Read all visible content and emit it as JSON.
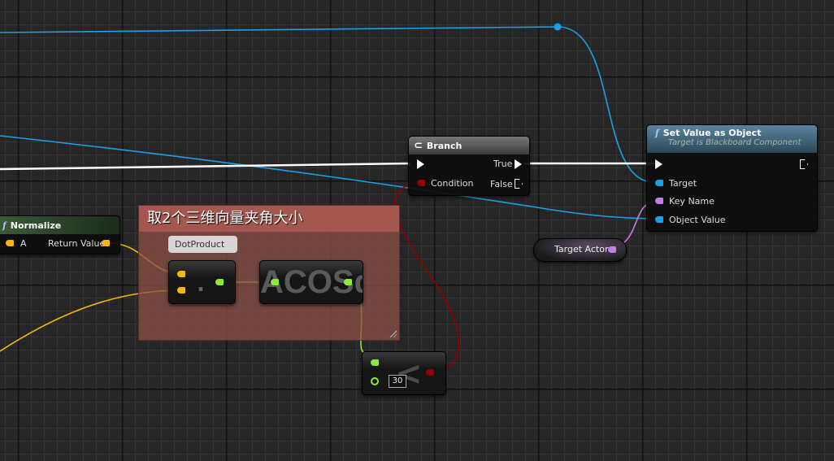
{
  "comment": {
    "title": "取2个三维向量夹角大小",
    "color": "#a3574e"
  },
  "normalize": {
    "title": "Normalize",
    "pin_in": "A",
    "pin_out": "Return Value",
    "icon": "function-icon"
  },
  "dot_product": {
    "tooltip": "DotProduct",
    "symbol": "."
  },
  "acos": {
    "title": "ACOSd"
  },
  "compare": {
    "symbol": "<",
    "value": "30"
  },
  "branch": {
    "title": "Branch",
    "icon": "branch-icon",
    "pin_true": "True",
    "pin_false": "False",
    "pin_condition": "Condition"
  },
  "set_value": {
    "title": "Set Value as Object",
    "subtitle": "Target is Blackboard Component",
    "pins": [
      "Target",
      "Key Name",
      "Object Value"
    ],
    "icon": "function-icon"
  },
  "target_actor": {
    "label": "Target Actor"
  },
  "colors": {
    "object": "#1aa0e6",
    "vector": "#f5b800",
    "float": "#8ee83a",
    "bool": "#930000",
    "name": "#c37ee6",
    "exec": "#ffffff"
  }
}
